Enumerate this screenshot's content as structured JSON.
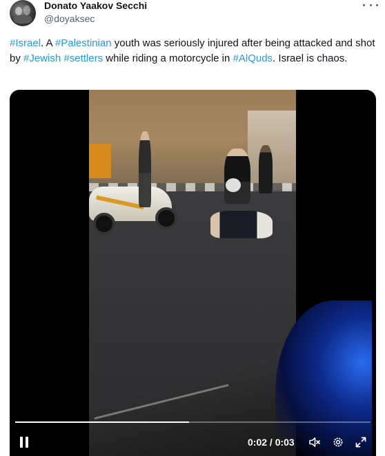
{
  "user": {
    "display_name": "Donato Yaakov Secchi",
    "handle": "@doyaksec",
    "avatar_icon": "profile-photo"
  },
  "more_icon": "ellipsis-icon",
  "tweet": {
    "segments": [
      {
        "text": "#Israel",
        "link": true
      },
      {
        "text": ". A ",
        "link": false
      },
      {
        "text": "#Palestinian",
        "link": true
      },
      {
        "text": " youth was seriously injured after being attacked and shot by ",
        "link": false
      },
      {
        "text": "#Jewish",
        "link": true
      },
      {
        "text": " ",
        "link": false
      },
      {
        "text": "#settlers",
        "link": true
      },
      {
        "text": " while riding a motorcycle in ",
        "link": false
      },
      {
        "text": "#AlQuds",
        "link": true
      },
      {
        "text": ". Israel is chaos.",
        "link": false
      }
    ]
  },
  "video": {
    "time_display": "0:02 / 0:03",
    "progress_fraction": 0.49,
    "controls": {
      "play_state_icon": "pause-icon",
      "mute_icon": "muted-speaker-icon",
      "settings_icon": "gear-icon",
      "fullscreen_icon": "expand-icon"
    }
  },
  "colors": {
    "link": "#1d9bf0",
    "text": "#0f1419",
    "secondary": "#536471",
    "video_bg": "#000000",
    "emergency_blue": "#2a6bf0"
  }
}
